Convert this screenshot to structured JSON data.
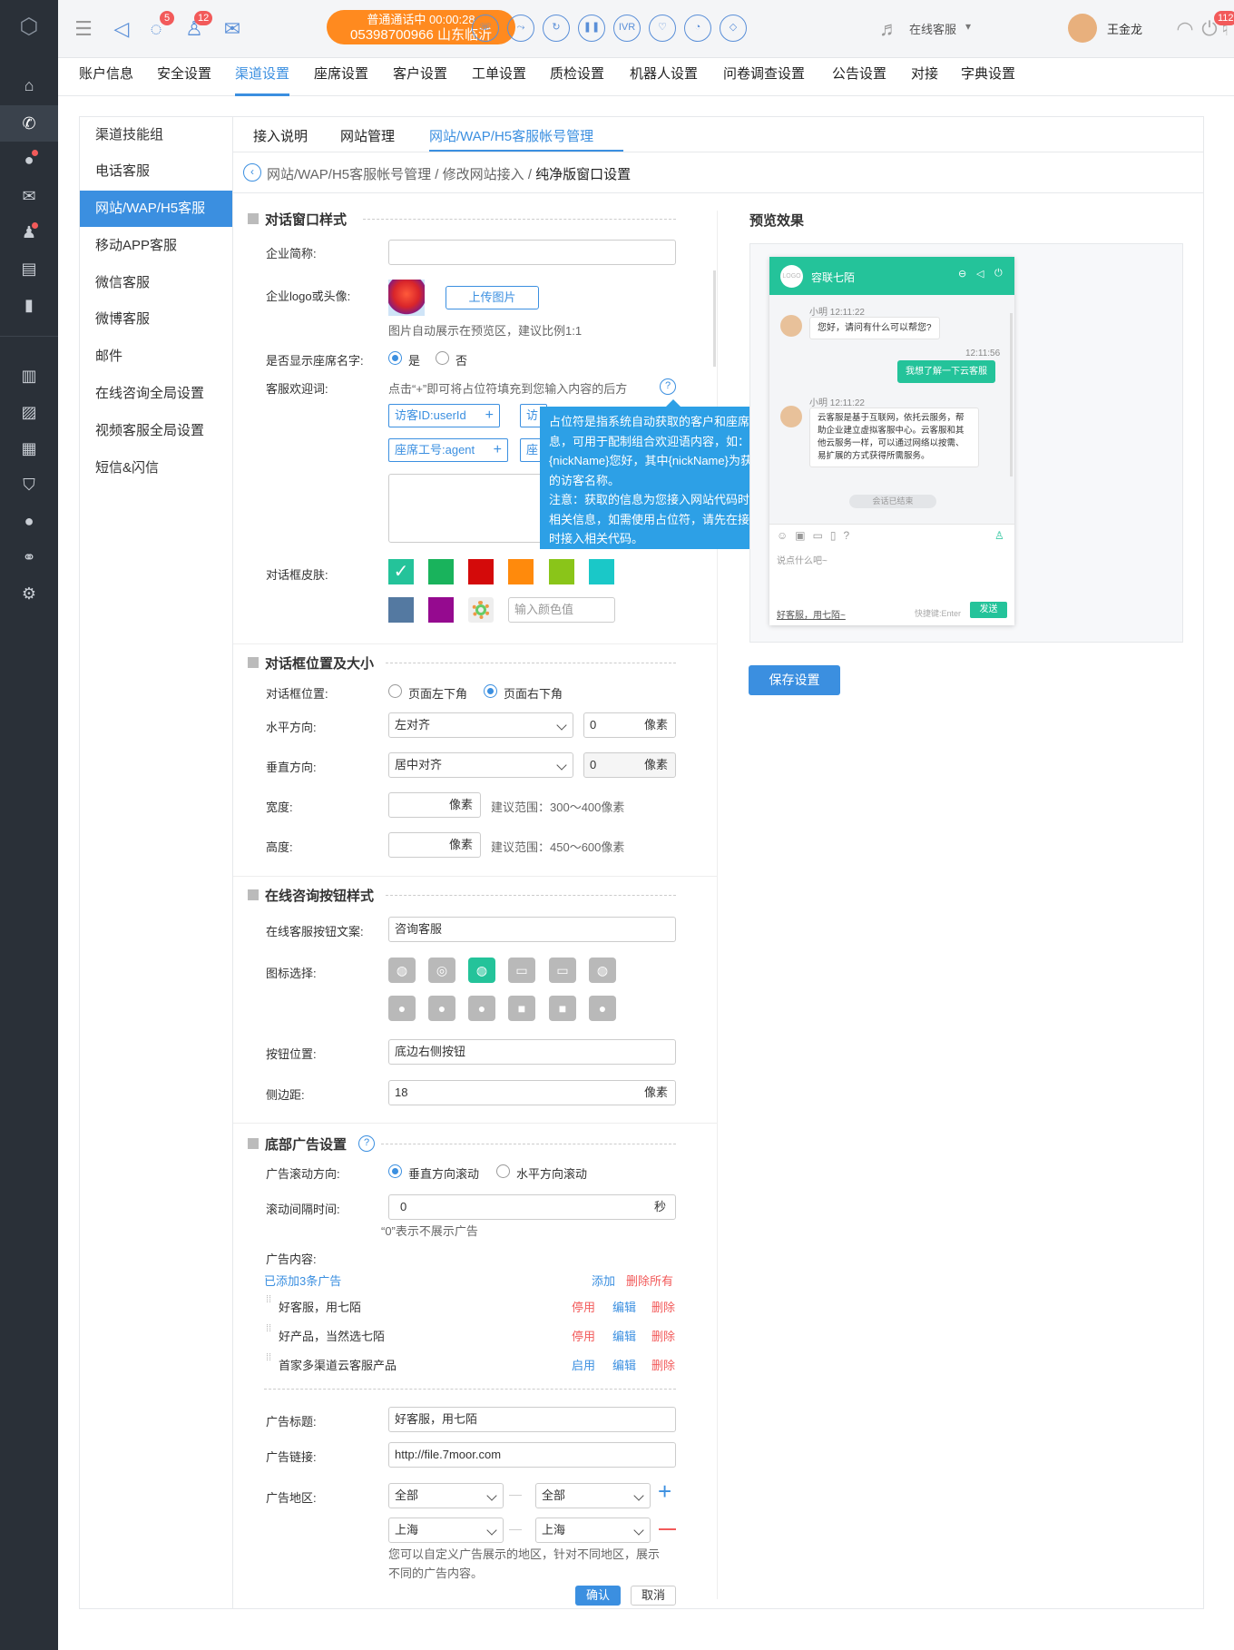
{
  "rail": {
    "icons": [
      "logo-icon",
      "home-icon",
      "phone-icon",
      "chat-icon",
      "mail-icon",
      "contacts-icon",
      "clipboard-icon",
      "book-icon",
      "bar-chart-icon",
      "pulse-icon",
      "calendar-icon",
      "shield-icon",
      "message-icon",
      "link-icon",
      "settings-icon"
    ]
  },
  "topbar": {
    "chat_badge": "5",
    "contacts_badge": "12",
    "notify_badge": "112",
    "call_status": "普通通话中  00:00:28",
    "call_number": "05398700966 山东临沂",
    "call_buttons": [
      "hangup",
      "transfer",
      "refresh",
      "pause",
      "IVR",
      "satisfaction",
      "message",
      "tag"
    ],
    "ivr_label": "IVR",
    "online_status": "在线客服",
    "user_name": "王金龙"
  },
  "topnav": {
    "items": [
      "账户信息",
      "安全设置",
      "渠道设置",
      "座席设置",
      "客户设置",
      "工单设置",
      "质检设置",
      "机器人设置",
      "问卷调查设置",
      "公告设置",
      "对接",
      "字典设置"
    ],
    "active": 2
  },
  "leftmenu": {
    "items": [
      "渠道技能组",
      "电话客服",
      "网站/WAP/H5客服",
      "移动APP客服",
      "微信客服",
      "微博客服",
      "邮件",
      "在线咨询全局设置",
      "视频客服全局设置",
      "短信&闪信"
    ],
    "active": 2
  },
  "subtabs": {
    "items": [
      "接入说明",
      "网站管理",
      "网站/WAP/H5客服帐号管理"
    ],
    "active": 2
  },
  "breadcrumb": {
    "part1": "网站/WAP/H5客服帐号管理",
    "sep": "/",
    "part2": "修改网站接入",
    "part3": "纯净版窗口设置"
  },
  "style_section": {
    "title": "对话窗口样式",
    "company_label": "企业简称:",
    "company_value": "",
    "logo_label": "企业logo或头像:",
    "upload_label": "上传图片",
    "logo_hint": "图片自动展示在预览区，建议比例1:1",
    "show_name_label": "是否显示座席名字:",
    "opt_yes": "是",
    "opt_no": "否",
    "welcome_label": "客服欢迎词:",
    "welcome_hint": "点击“+”即可将占位符填充到您输入内容的后方",
    "tags": [
      "访客ID:userId",
      "访",
      "座席工号:agent",
      "座"
    ],
    "skin_label": "对话框皮肤:",
    "skins": [
      "#24c39a",
      "#19b35c",
      "#d40a0a",
      "#ff8a0c",
      "#8ac519",
      "#1ac8c8",
      "#5479a1",
      "#950a8f"
    ],
    "color_placeholder": "输入颜色值"
  },
  "tooltip": {
    "line1": "占位符是指系统自动获取的客户和座席相关信息，可用于配制组合欢迎语内容，如：亲爱的{nickName}您好，其中{nickName}为获取到的访客名称。",
    "line2": "注意：获取的信息为您接入网站代码时定义的相关信息，如需使用占位符，请先在接入网站时接入相关代码。"
  },
  "position_section": {
    "title": "对话框位置及大小",
    "pos_label": "对话框位置:",
    "pos_left": "页面左下角",
    "pos_right": "页面右下角",
    "h_label": "水平方向:",
    "h_value": "左对齐",
    "h_px": "0",
    "unit": "像素",
    "v_label": "垂直方向:",
    "v_value": "居中对齐",
    "v_px": "0",
    "w_label": "宽度:",
    "w_hint": "建议范围：300～400像素",
    "ht_label": "高度:",
    "ht_hint": "建议范围：450～600像素"
  },
  "button_section": {
    "title": "在线咨询按钮样式",
    "text_label": "在线客服按钮文案:",
    "text_value": "咨询客服",
    "icon_label": "图标选择:",
    "icons": [
      "chat-bubble-1-icon",
      "chat-bubble-2-icon",
      "chat-bubble-3-icon",
      "chat-bubble-4-icon",
      "chat-bubble-5-icon",
      "chat-bubble-6-icon",
      "chat-bubble-7-icon",
      "chat-bubble-8-icon",
      "chat-bubble-9-icon",
      "chat-bubble-10-icon",
      "chat-bubble-11-icon",
      "chat-bubble-12-icon"
    ],
    "pos_label": "按钮位置:",
    "pos_value": "底边右侧按钮",
    "margin_label": "侧边距:",
    "margin_value": "18",
    "unit": "像素"
  },
  "ad_section": {
    "title": "底部广告设置",
    "dir_label": "广告滚动方向:",
    "dir_v": "垂直方向滚动",
    "dir_h": "水平方向滚动",
    "interval_label": "滚动间隔时间:",
    "interval_value": "0",
    "interval_unit": "秒",
    "interval_hint": "“0”表示不展示广告",
    "content_label": "广告内容:",
    "count_text": "已添加3条广告",
    "add": "添加",
    "delete_all": "删除所有",
    "ads": [
      {
        "text": "好客服，用七陌",
        "toggle": "停用",
        "edit": "编辑",
        "del": "删除"
      },
      {
        "text": "好产品，当然选七陌",
        "toggle": "停用",
        "edit": "编辑",
        "del": "删除"
      },
      {
        "text": "首家多渠道云客服产品",
        "toggle": "启用",
        "edit": "编辑",
        "del": "删除"
      }
    ],
    "title_label": "广告标题:",
    "title_value": "好客服，用七陌",
    "link_label": "广告链接:",
    "link_value": "http://file.7moor.com",
    "region_label": "广告地区:",
    "r1a": "全部",
    "r1b": "全部",
    "r2a": "上海",
    "r2b": "上海",
    "dash": "—",
    "region_hint1": "您可以自定义广告展示的地区，针对不同地区，展示",
    "region_hint2": "不同的广告内容。",
    "confirm": "确认",
    "cancel": "取消"
  },
  "preview": {
    "title": "预览效果",
    "logo_text": "LOGO",
    "brand": "容联七陌",
    "m1_meta": "小明 12:11:22",
    "m1_text": "您好，请问有什么可以帮您?",
    "m2_time": "12:11:56",
    "m2_text": "我想了解一下云客服",
    "m3_meta": "小明 12:11:22",
    "m3_text": "云客服是基于互联网，依托云服务，帮助企业建立虚拟客服中心。云客服和其他云服务一样，可以通过网络以按需、易扩展的方式获得所需服务。",
    "ended": "会话已结束",
    "input_placeholder": "说点什么吧~",
    "footer_ad": "好客服，用七陌~",
    "shortcut": "快捷键:Enter",
    "send": "发送",
    "save": "保存设置"
  }
}
